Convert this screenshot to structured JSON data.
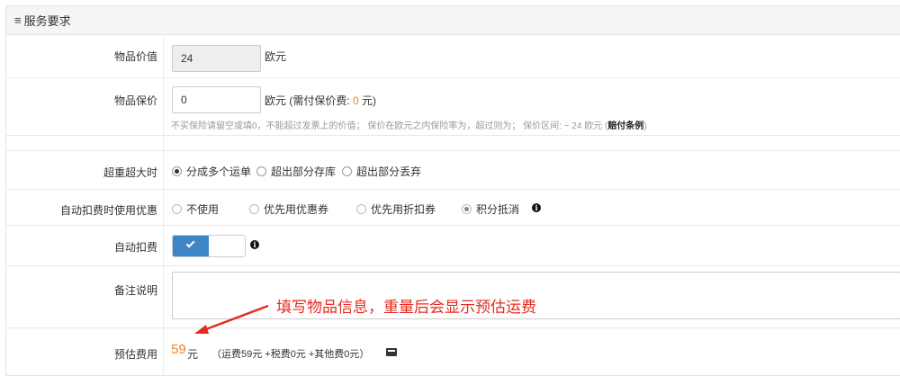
{
  "panel": {
    "title": "服务要求",
    "menu_icon": "≡"
  },
  "item_value": {
    "label": "物品价值",
    "value": "24",
    "unit": "欧元"
  },
  "item_insure": {
    "label": "物品保价",
    "value": "0",
    "unit_prefix": "欧元 (需付保价费: ",
    "fee": "0",
    "unit_suffix": " 元)",
    "hint": "不买保险请留空或填0，不能超过发票上的价值； 保价在欧元之内保险率为，超过则为； 保价区间: ~ 24 欧元 (",
    "hint_link": "赔付条例",
    "hint_end": ")"
  },
  "overweight": {
    "label": "超重超大时",
    "options": [
      "分成多个运单",
      "超出部分存库",
      "超出部分丢弃"
    ],
    "selected": 0
  },
  "auto_discount": {
    "label": "自动扣费时使用优惠",
    "options": [
      "不使用",
      "优先用优惠券",
      "优先用折扣券",
      "积分抵消"
    ],
    "selected": 3
  },
  "auto_charge": {
    "label": "自动扣费",
    "enabled": true
  },
  "remark": {
    "label": "备注说明",
    "value": ""
  },
  "annotation": {
    "text": "填写物品信息，重量后会显示预估运费",
    "color": "#e52b1e"
  },
  "estimate": {
    "label": "预估费用",
    "amount": "59",
    "currency": "元",
    "breakdown": "（运费59元 +税费0元 +其他费0元）"
  },
  "colors": {
    "accent_orange": "#f0811f",
    "toggle_blue": "#3e85c6",
    "annotation_red": "#e52b1e"
  }
}
